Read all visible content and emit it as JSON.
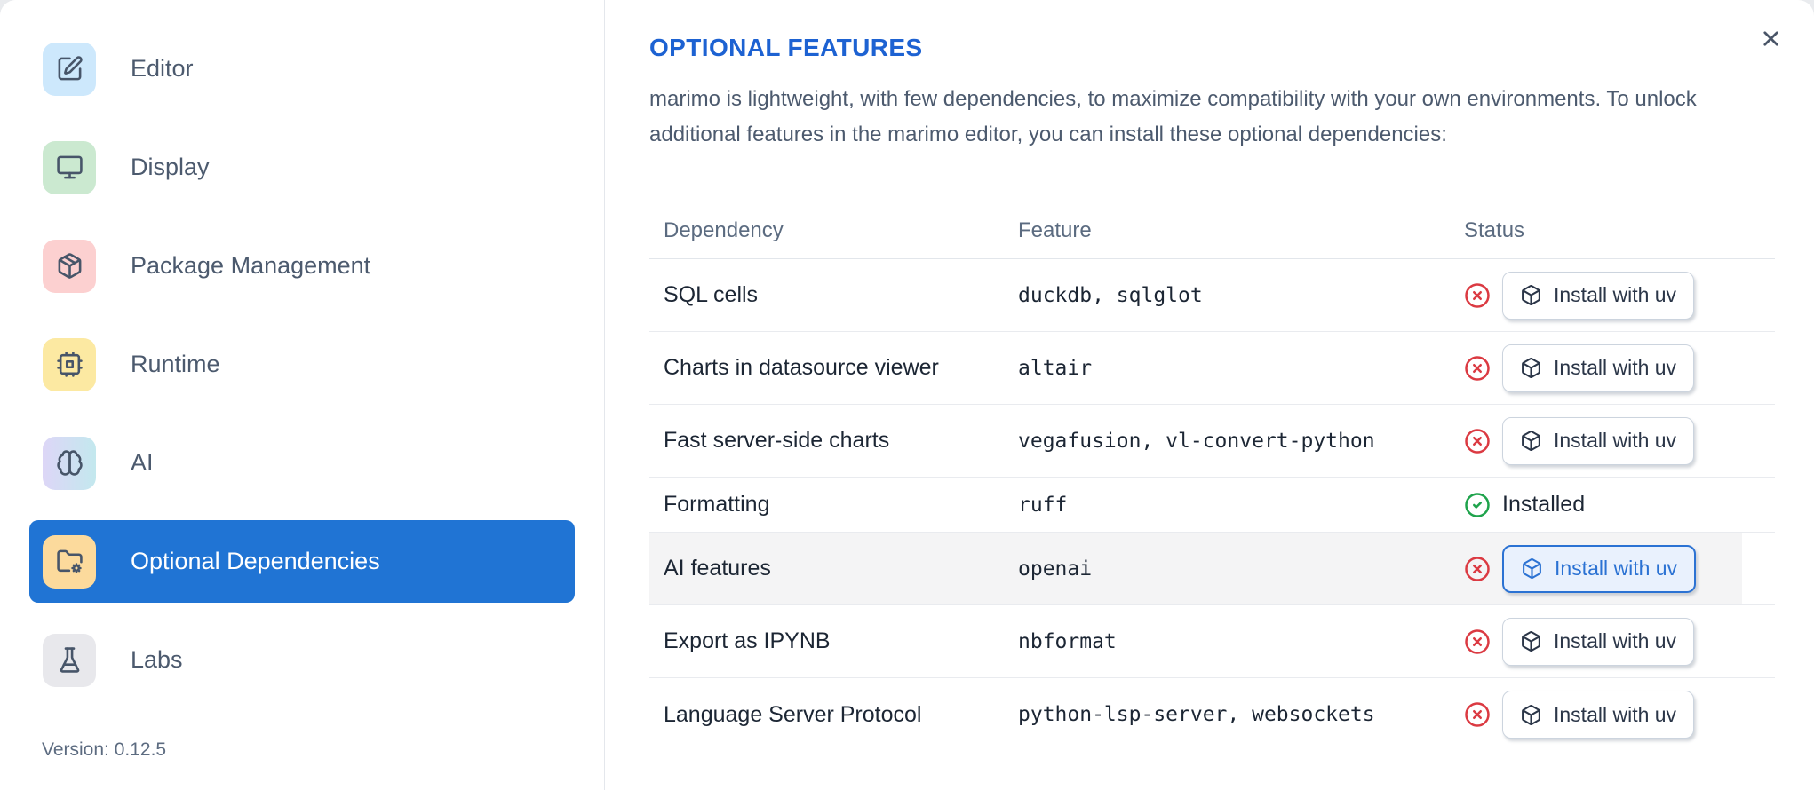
{
  "colors": {
    "accent_blue": "#2074d4",
    "title_blue": "#1d62d2",
    "status_red": "#db3a42",
    "status_green": "#1fa34c",
    "focused_button_blue": "#2b72d3",
    "focused_button_bg": "#e9f1fd",
    "highlighted_row_bg": "#f4f4f5",
    "icon_bg_editor": "#cde8fc",
    "icon_bg_display": "#cbe9d0",
    "icon_bg_package_management": "#fcd0d0",
    "icon_bg_runtime": "#fce9a2",
    "icon_bg_ai_start": "#ddd6f7",
    "icon_bg_ai_end": "#c3e8ee",
    "icon_bg_optional_dependencies": "#fcda9c",
    "icon_bg_labs": "#e8e8ec"
  },
  "sidebar": {
    "items": [
      {
        "label": "Editor",
        "icon": "edit-pencil-icon",
        "selected": false
      },
      {
        "label": "Display",
        "icon": "monitor-icon",
        "selected": false
      },
      {
        "label": "Package Management",
        "icon": "package-icon",
        "selected": false
      },
      {
        "label": "Runtime",
        "icon": "cpu-icon",
        "selected": false
      },
      {
        "label": "AI",
        "icon": "brain-icon",
        "selected": false
      },
      {
        "label": "Optional Dependencies",
        "icon": "folder-gear-icon",
        "selected": true
      },
      {
        "label": "Labs",
        "icon": "flask-icon",
        "selected": false
      }
    ],
    "version_label": "Version: 0.12.5"
  },
  "main": {
    "title": "OPTIONAL FEATURES",
    "description": "marimo is lightweight, with few dependencies, to maximize compatibility with your own environments. To unlock additional features in the marimo editor, you can install these optional dependencies:",
    "table": {
      "columns": [
        "Dependency",
        "Feature",
        "Status"
      ],
      "installed_label": "Installed",
      "install_button_label": "Install with uv",
      "rows": [
        {
          "dependency": "SQL cells",
          "feature": "duckdb, sqlglot",
          "status": "not-installed",
          "action": "Install with uv"
        },
        {
          "dependency": "Charts in datasource viewer",
          "feature": "altair",
          "status": "not-installed",
          "action": "Install with uv"
        },
        {
          "dependency": "Fast server-side charts",
          "feature": "vegafusion, vl-convert-python",
          "status": "not-installed",
          "action": "Install with uv"
        },
        {
          "dependency": "Formatting",
          "feature": "ruff",
          "status": "installed",
          "status_label": "Installed"
        },
        {
          "dependency": "AI features",
          "feature": "openai",
          "status": "not-installed",
          "action": "Install with uv",
          "highlighted": true
        },
        {
          "dependency": "Export as IPYNB",
          "feature": "nbformat",
          "status": "not-installed",
          "action": "Install with uv"
        },
        {
          "dependency": "Language Server Protocol",
          "feature": "python-lsp-server, websockets",
          "status": "not-installed",
          "action": "Install with uv"
        }
      ]
    }
  }
}
